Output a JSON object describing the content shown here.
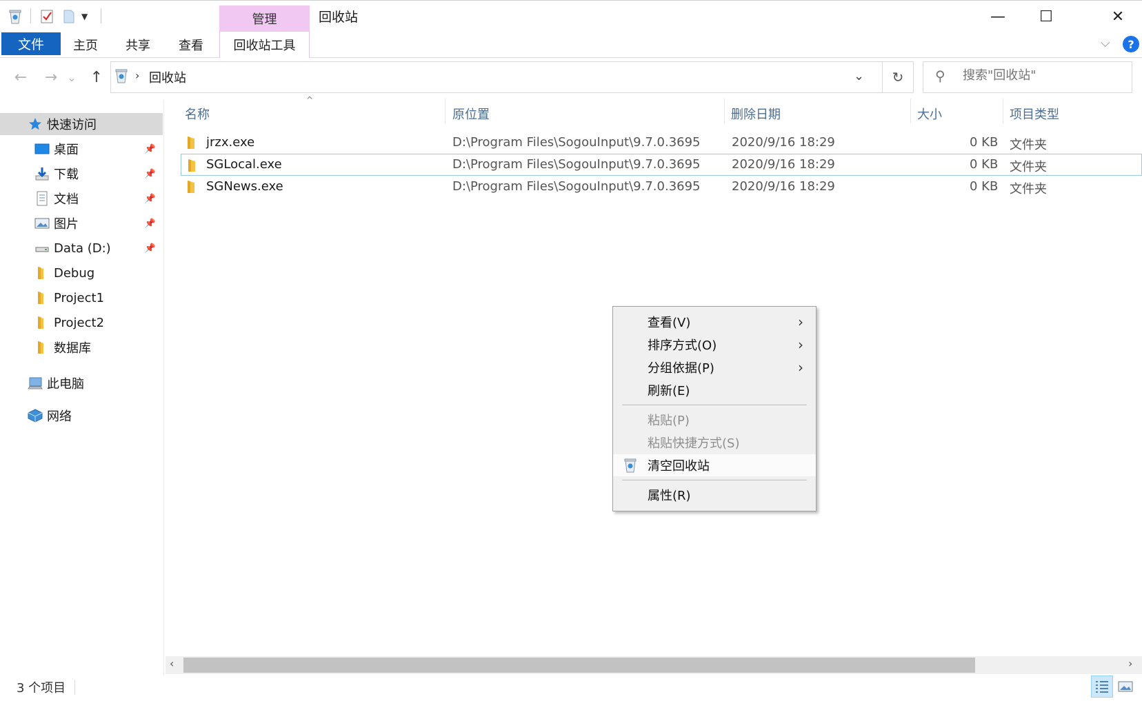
{
  "window": {
    "title": "回收站",
    "manage_tab": "管理",
    "minimize": "—",
    "maximize": "☐",
    "close": "✕"
  },
  "ribbon": {
    "tabs": {
      "file": "文件",
      "home": "主页",
      "share": "共享",
      "view": "查看",
      "recycle_tools": "回收站工具"
    },
    "help": "?",
    "collapse": "⌵"
  },
  "address": {
    "back": "←",
    "forward": "→",
    "recent": "⌄",
    "up": "↑",
    "separator": "›",
    "path": "回收站",
    "dropdown": "⌄",
    "refresh": "↻"
  },
  "search": {
    "placeholder": "搜索\"回收站\""
  },
  "nav": {
    "quick_access": "快速访问",
    "desktop": "桌面",
    "downloads": "下载",
    "documents": "文档",
    "pictures": "图片",
    "data_drive": "Data (D:)",
    "debug": "Debug",
    "project1": "Project1",
    "project2": "Project2",
    "database": "数据库",
    "this_pc": "此电脑",
    "network": "网络",
    "pin": "📌"
  },
  "columns": {
    "name": "名称",
    "original_location": "原位置",
    "date_deleted": "删除日期",
    "size": "大小",
    "item_type": "项目类型",
    "sort_indicator": "^"
  },
  "rows": [
    {
      "name": "jrzx.exe",
      "location": "D:\\Program Files\\SogouInput\\9.7.0.3695",
      "date": "2020/9/16 18:29",
      "size": "0 KB",
      "type": "文件夹"
    },
    {
      "name": "SGLocal.exe",
      "location": "D:\\Program Files\\SogouInput\\9.7.0.3695",
      "date": "2020/9/16 18:29",
      "size": "0 KB",
      "type": "文件夹"
    },
    {
      "name": "SGNews.exe",
      "location": "D:\\Program Files\\SogouInput\\9.7.0.3695",
      "date": "2020/9/16 18:29",
      "size": "0 KB",
      "type": "文件夹"
    }
  ],
  "context_menu": {
    "view": "查看(V)",
    "sort_by": "排序方式(O)",
    "group_by": "分组依据(P)",
    "refresh": "刷新(E)",
    "paste": "粘贴(P)",
    "paste_shortcut": "粘贴快捷方式(S)",
    "empty_recycle_bin": "清空回收站",
    "properties": "属性(R)",
    "submenu_arrow": "›"
  },
  "scrollbar": {
    "left": "‹",
    "right": "›"
  },
  "status": {
    "item_count": "3 个项目"
  },
  "colors": {
    "accent": "#1565c0",
    "manage_tab": "#f0c8f2",
    "header_text": "#4d6d93",
    "selection_border": "#99c9ef"
  }
}
